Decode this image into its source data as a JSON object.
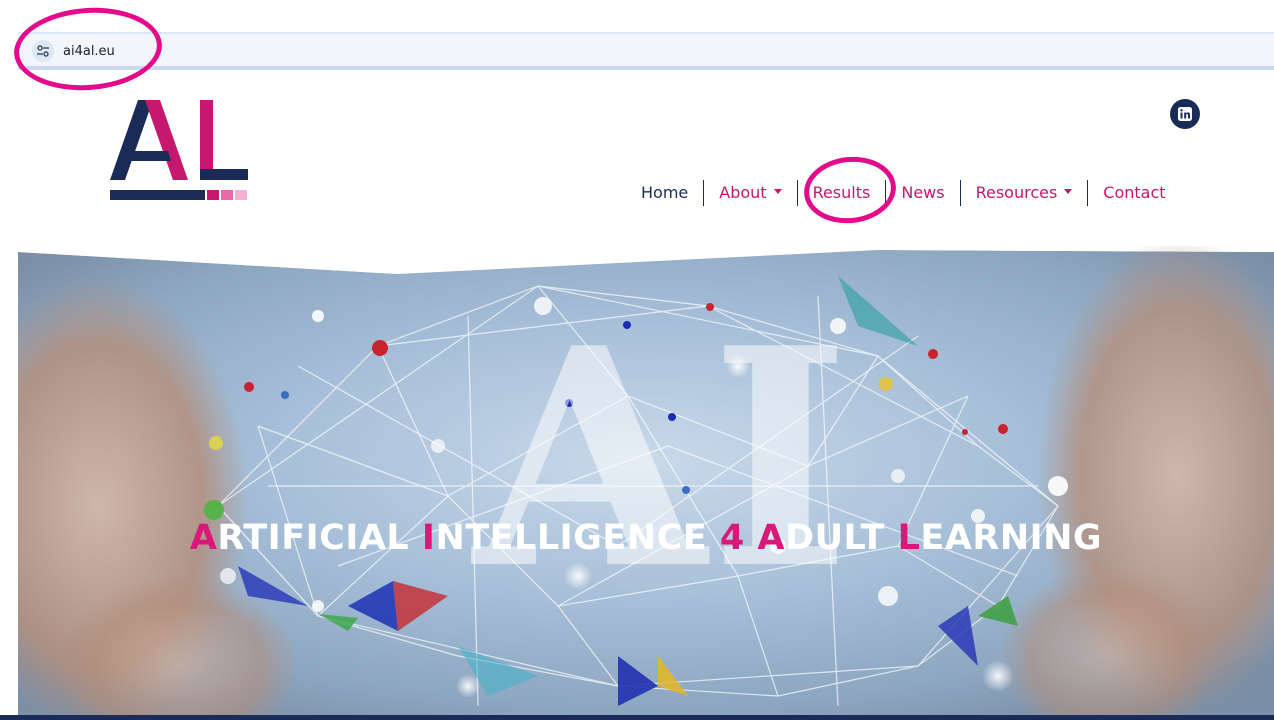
{
  "browser": {
    "url": "ai4al.eu",
    "site_controls_icon": "tune-icon"
  },
  "header": {
    "logo_text": "AL",
    "social_icon": "linkedin-icon",
    "nav": {
      "home": "Home",
      "about": "About",
      "results": "Results",
      "news": "News",
      "resources": "Resources",
      "contact": "Contact"
    }
  },
  "hero": {
    "background_word": "AI",
    "title": [
      {
        "first": "A",
        "rest": "RTIFICIAL "
      },
      {
        "first": "I",
        "rest": "NTELLIGENCE "
      },
      {
        "first": "4",
        "rest": " "
      },
      {
        "first": "A",
        "rest": "DULT "
      },
      {
        "first": "L",
        "rest": "EARNING"
      }
    ]
  },
  "colors": {
    "brand_navy": "#1b2b58",
    "brand_pink": "#c6186f",
    "annotation_magenta": "#e50a8b"
  }
}
